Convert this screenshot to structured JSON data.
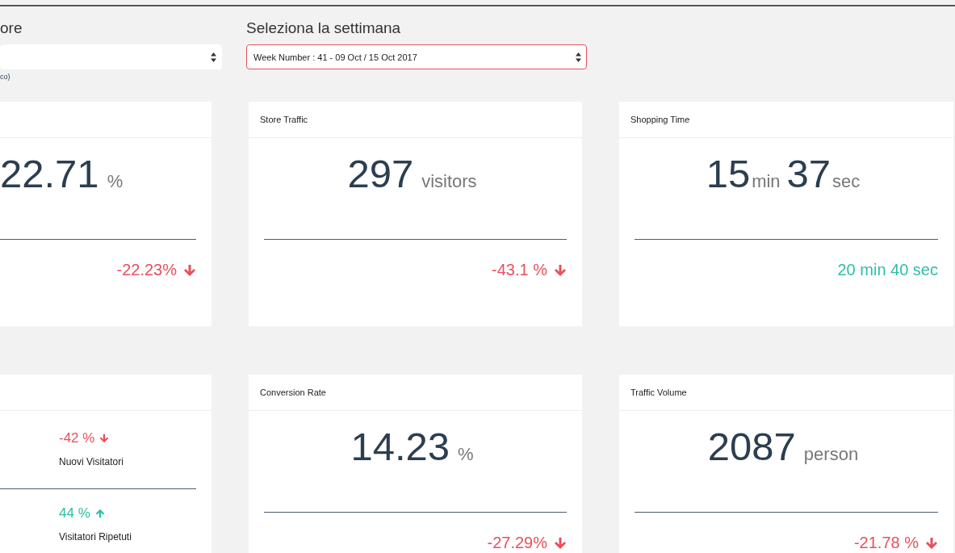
{
  "filters": [
    {
      "label": "ore",
      "note": "co)",
      "highlighted": false
    },
    {
      "label": "Seleziona la settimana",
      "value": "Week Number : 41 - 09 Oct / 15 Oct 2017",
      "highlighted": true
    }
  ],
  "rows": [
    {
      "cards": [
        {
          "kind": "single",
          "values": [
            {
              "number": "22.71",
              "unit": "%"
            }
          ],
          "change": {
            "text": "-22.23%",
            "negative": true
          }
        },
        {
          "kind": "single",
          "title": "Store Traffic",
          "values": [
            {
              "number": "297",
              "unit": "visitors"
            }
          ],
          "change": {
            "text": "-43.1 %",
            "negative": true
          }
        },
        {
          "kind": "single",
          "title": "Shopping Time",
          "values": [
            {
              "number": "15",
              "unit": "min"
            },
            {
              "number": "37",
              "unit": "sec"
            }
          ],
          "change": {
            "text": "20 min 40 sec",
            "negative": false
          }
        }
      ]
    },
    {
      "cards": [
        {
          "kind": "split",
          "items": [
            {
              "change": {
                "text": "-42 %",
                "negative": true
              },
              "label": "Nuovi Visitatori"
            },
            {
              "change": {
                "text": "44 %",
                "negative": false
              },
              "label": "Visitatori Ripetuti"
            }
          ]
        },
        {
          "kind": "single",
          "title": "Conversion Rate",
          "values": [
            {
              "number": "14.23",
              "unit": "%"
            }
          ],
          "change": {
            "text": "-27.29%",
            "negative": true
          }
        },
        {
          "kind": "single",
          "title": "Traffic Volume",
          "values": [
            {
              "number": "2087",
              "unit": "person"
            }
          ],
          "change": {
            "text": "-21.78 %",
            "negative": true
          }
        }
      ]
    }
  ]
}
